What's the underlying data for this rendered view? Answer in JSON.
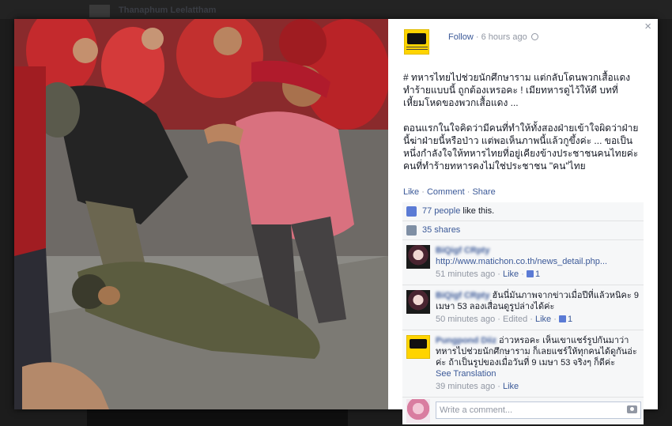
{
  "background": {
    "name": "Thanaphum Leelattham"
  },
  "photo": {
    "description_icon": "photo-icon"
  },
  "header": {
    "follow_label": "Follow",
    "separator": "·",
    "time": "6 hours ago",
    "close_label": "×"
  },
  "caption": {
    "paragraph_1": "# ทหารไทยไปช่วยนักศึกษาราม แต่กลับโดนพวกเสื้อแดงทำร้ายแบบนี้ ถูกต้องเหรอคะ ! เมียทหารดูไว้ให้ดี บทที่เหี้ยมโหดของพวกเสื้อแดง ...",
    "paragraph_2": "ตอนแรกในใจคิดว่ามีคนที่ทำให้ทั้งสองฝ่ายเข้าใจผิดว่าฝ่ายนี้ฆ่าฝ่ายนี้หรือป่าว แต่พอเห็นภาพนี้แล้วกูขึ้งค่ะ ... ขอเป็นหนึ่งกำลังใจให้ทหารไทยที่อยู่เคียงข้างประชาชนคนไทยค่ะ คนที่ทำร้ายทหารคงไม่ใช่ประชาชน \"คน\"ไทย"
  },
  "actions": {
    "like": "Like",
    "comment": "Comment",
    "share": "Share",
    "sep": " · "
  },
  "ufi": {
    "likes_count": "77 people",
    "likes_suffix": " like this.",
    "shares": "35 shares"
  },
  "comments": [
    {
      "name": "BiQigf CRpty",
      "text_link": "http://www.matichon.co.th/news_detail.php...",
      "time": "51 minutes ago",
      "like": "Like",
      "like_count": "1"
    },
    {
      "name": "BiQigf CRpty",
      "text": "ฮันนี่มันภาพจากข่าวเมื่อปีที่แล้วหนิคะ 9 เมษา 53 ลองเสื่อนดูรูปล่างได้ค่ะ",
      "time": "50 minutes ago",
      "edited": "Edited",
      "like": "Like",
      "like_count": "1"
    },
    {
      "name": "Pungpond Diiz",
      "text": "อ่าวหรอคะ เห็นเขาแชร์รูปกันมาว่า ทหารไปช่วยนักศึกษาราม ก็เลยแชร์ให้ทุกคนได้ดูกันอ่ะค่ะ ถ้าเป็นรูปของเมื่อวันที่ 9 เมษา 53 จริงๆ ก็ดีค่ะ",
      "translation": "See Translation",
      "time": "39 minutes ago",
      "like": "Like"
    }
  ],
  "composer": {
    "placeholder": "Write a comment..."
  },
  "colors": {
    "link": "#3b5998",
    "muted": "#9197a3",
    "ufi_bg": "#f6f7f8",
    "page_logo": "#ffd400"
  }
}
